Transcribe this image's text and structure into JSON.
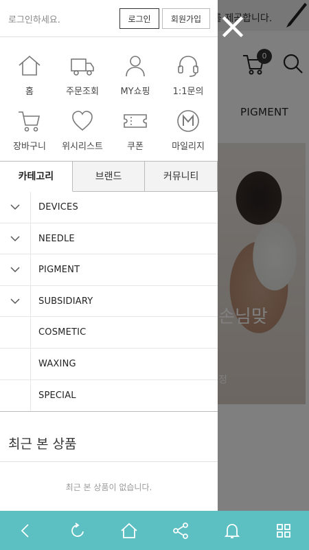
{
  "background": {
    "banner_text": "를 제공합니다.",
    "cart_count": "0",
    "category": "PIGMENT",
    "overlay_text_1": "손님맞",
    "overlay_text_2": "정"
  },
  "drawer": {
    "login_message": "로그인하세요.",
    "login_button": "로그인",
    "join_button": "회원가입",
    "quick_menu": [
      {
        "label": "홈",
        "icon": "home-icon"
      },
      {
        "label": "주문조회",
        "icon": "truck-icon"
      },
      {
        "label": "MY쇼핑",
        "icon": "user-icon"
      },
      {
        "label": "1:1문의",
        "icon": "headset-icon"
      },
      {
        "label": "장바구니",
        "icon": "cart-icon"
      },
      {
        "label": "위시리스트",
        "icon": "heart-icon"
      },
      {
        "label": "쿠폰",
        "icon": "coupon-icon"
      },
      {
        "label": "마일리지",
        "icon": "mileage-icon"
      }
    ],
    "tabs": [
      "카테고리",
      "브랜드",
      "커뮤니티"
    ],
    "active_tab": "카테고리",
    "categories": [
      {
        "label": "DEVICES",
        "expandable": true
      },
      {
        "label": "NEEDLE",
        "expandable": true
      },
      {
        "label": "PIGMENT",
        "expandable": true
      },
      {
        "label": "SUBSIDIARY",
        "expandable": true
      },
      {
        "label": "COSMETIC",
        "expandable": false
      },
      {
        "label": "WAXING",
        "expandable": false
      },
      {
        "label": "SPECIAL",
        "expandable": false
      }
    ],
    "recent_title": "최근 본 상품",
    "recent_empty": "최근 본 상품이 없습니다."
  },
  "bottom_bar": {
    "icons": [
      "back-icon",
      "refresh-icon",
      "home-icon",
      "share-icon",
      "bell-icon",
      "grid-icon"
    ],
    "color": "#5cc0c2"
  }
}
